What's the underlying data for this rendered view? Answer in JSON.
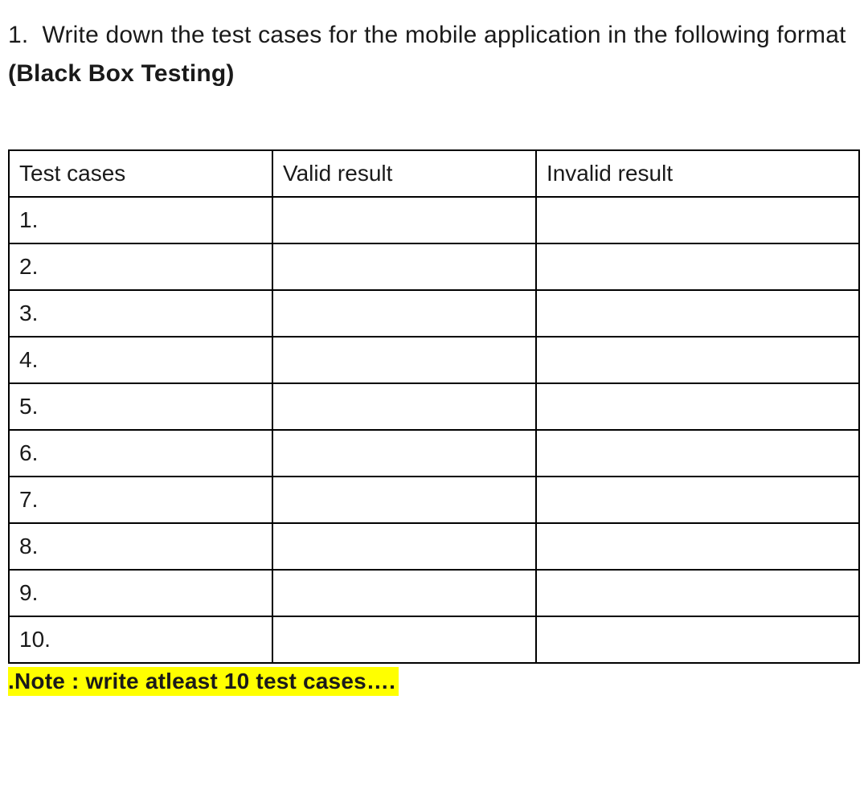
{
  "question": {
    "number": "1.",
    "text_part1": "Write down the test cases for the mobile application in the following format",
    "text_part2_bold": "(Black Box Testing)"
  },
  "table": {
    "headers": {
      "col1": "Test cases",
      "col2": "Valid result",
      "col3": "Invalid result"
    },
    "rows": [
      {
        "testcase": "1.",
        "valid": "",
        "invalid": ""
      },
      {
        "testcase": "2.",
        "valid": "",
        "invalid": ""
      },
      {
        "testcase": "3.",
        "valid": "",
        "invalid": ""
      },
      {
        "testcase": "4.",
        "valid": "",
        "invalid": ""
      },
      {
        "testcase": "5.",
        "valid": "",
        "invalid": ""
      },
      {
        "testcase": "6.",
        "valid": "",
        "invalid": ""
      },
      {
        "testcase": "7.",
        "valid": "",
        "invalid": ""
      },
      {
        "testcase": "8.",
        "valid": "",
        "invalid": ""
      },
      {
        "testcase": "9.",
        "valid": "",
        "invalid": ""
      },
      {
        "testcase": "10.",
        "valid": "",
        "invalid": ""
      }
    ]
  },
  "note": ".Note : write atleast 10 test cases…."
}
